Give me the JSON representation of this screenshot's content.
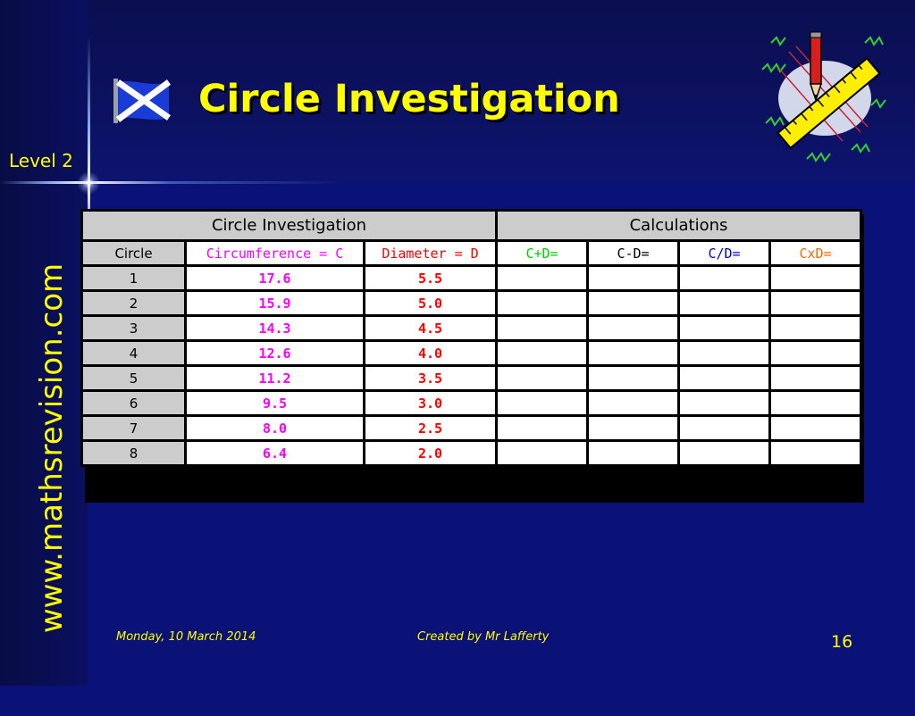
{
  "slide": {
    "title": "Circle Investigation",
    "level": "Level 2",
    "side_url": "www.mathsrevision.com",
    "footer_date": "Monday, 10 March 2014",
    "footer_author": "Created by Mr Lafferty",
    "page_number": "16"
  },
  "colors": {
    "background": "#0b1277",
    "text_accent": "#ffff00",
    "circumference": "#ff00ff",
    "diameter": "#ff0000",
    "c_plus_d": "#00cc00",
    "c_minus_d": "#000000",
    "c_over_d": "#0000cc",
    "c_times_d": "#ff6600"
  },
  "icons": {
    "flag": "scotland-flag-icon",
    "clipart": "pencil-ruler-icon"
  },
  "table": {
    "group_headers": [
      "Circle Investigation",
      "Calculations"
    ],
    "columns": [
      "Circle",
      "Circumference = C",
      "Diameter = D",
      "C+D=",
      "C-D=",
      "C/D=",
      "CxD="
    ],
    "rows": [
      {
        "circle": "1",
        "circumference": "17.6",
        "diameter": "5.5"
      },
      {
        "circle": "2",
        "circumference": "15.9",
        "diameter": "5.0"
      },
      {
        "circle": "3",
        "circumference": "14.3",
        "diameter": "4.5"
      },
      {
        "circle": "4",
        "circumference": "12.6",
        "diameter": "4.0"
      },
      {
        "circle": "5",
        "circumference": "11.2",
        "diameter": "3.5"
      },
      {
        "circle": "6",
        "circumference": "9.5",
        "diameter": "3.0"
      },
      {
        "circle": "7",
        "circumference": "8.0",
        "diameter": "2.5"
      },
      {
        "circle": "8",
        "circumference": "6.4",
        "diameter": "2.0"
      }
    ]
  }
}
